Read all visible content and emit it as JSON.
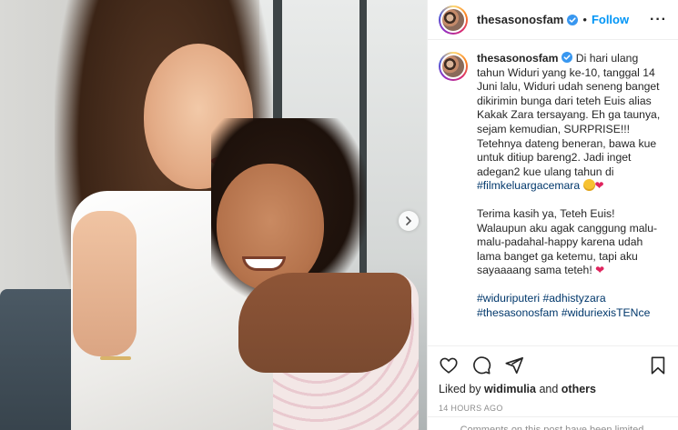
{
  "post": {
    "username": "thesasonosfam",
    "verified": true,
    "dot": "•",
    "follow_label": "Follow",
    "more_label": "···"
  },
  "caption": {
    "username": "thesasonosfam",
    "body": " Di hari ulang tahun Widuri yang ke-10, tanggal 14 Juni lalu, Widuri udah seneng banget dikirimin bunga dari teteh Euis alias Kakak Zara tersayang. Eh ga taunya, sejam kemudian, SURPRISE!!! Tetehnya dateng beneran, bawa kue untuk ditiup bareng2. Jadi inget adegan2 kue ulang tahun di ",
    "hashtag_film": "#filmkeluargacemara",
    "paragraph2": "Terima kasih ya, Teteh Euis! Walaupun aku agak canggung malu-malu-padahal-happy karena udah lama banget ga ketemu, tapi aku sayaaaang sama teteh! ",
    "hashtags": [
      "#widuriputeri",
      "#adhistyzara",
      "#thesasonosfam",
      "#widuriexisTENce"
    ]
  },
  "actions": {
    "like_icon": "heart-icon",
    "comment_icon": "comment-icon",
    "share_icon": "share-icon",
    "save_icon": "bookmark-icon"
  },
  "likes": {
    "prefix": "Liked by ",
    "user": "widimulia",
    "middle": " and ",
    "others": "others"
  },
  "timestamp": "14 HOURS AGO",
  "comments_notice": "Comments on this post have been limited.",
  "colors": {
    "accent": "#0095f6",
    "hashtag": "#00376b",
    "text": "#262626",
    "muted": "#8e8e8e"
  }
}
